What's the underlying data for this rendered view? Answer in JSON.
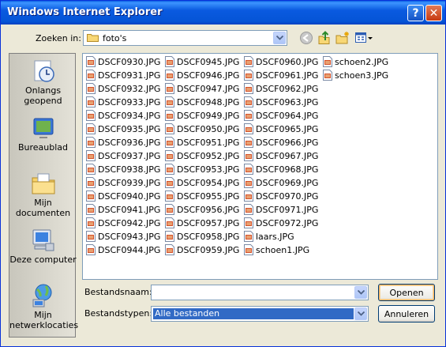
{
  "window": {
    "title": "Windows Internet Explorer"
  },
  "titlebar": {
    "help_glyph": "?",
    "close_glyph": "✕"
  },
  "lookin": {
    "label": "Zoeken in:",
    "value": "foto's"
  },
  "places": [
    {
      "label": "Onlangs geopend",
      "icon": "recent-icon"
    },
    {
      "label": "Bureaublad",
      "icon": "desktop-icon"
    },
    {
      "label": "Mijn documenten",
      "icon": "my-documents-icon"
    },
    {
      "label": "Deze computer",
      "icon": "my-computer-icon"
    },
    {
      "label": "Mijn netwerklocaties",
      "icon": "network-places-icon"
    }
  ],
  "files": {
    "col1": [
      "DSCF0930.JPG",
      "DSCF0931.JPG",
      "DSCF0932.JPG",
      "DSCF0933.JPG",
      "DSCF0934.JPG",
      "DSCF0935.JPG",
      "DSCF0936.JPG",
      "DSCF0937.JPG",
      "DSCF0938.JPG",
      "DSCF0939.JPG",
      "DSCF0940.JPG",
      "DSCF0941.JPG",
      "DSCF0942.JPG",
      "DSCF0943.JPG",
      "DSCF0944.JPG"
    ],
    "col2": [
      "DSCF0945.JPG",
      "DSCF0946.JPG",
      "DSCF0947.JPG",
      "DSCF0948.JPG",
      "DSCF0949.JPG",
      "DSCF0950.JPG",
      "DSCF0951.JPG",
      "DSCF0952.JPG",
      "DSCF0953.JPG",
      "DSCF0954.JPG",
      "DSCF0955.JPG",
      "DSCF0956.JPG",
      "DSCF0957.JPG",
      "DSCF0958.JPG",
      "DSCF0959.JPG"
    ],
    "col3": [
      "DSCF0960.JPG",
      "DSCF0961.JPG",
      "DSCF0962.JPG",
      "DSCF0963.JPG",
      "DSCF0964.JPG",
      "DSCF0965.JPG",
      "DSCF0966.JPG",
      "DSCF0967.JPG",
      "DSCF0968.JPG",
      "DSCF0969.JPG",
      "DSCF0970.JPG",
      "DSCF0971.JPG",
      "DSCF0972.JPG",
      "laars.JPG",
      "schoen1.JPG"
    ],
    "col4": [
      "schoen2.JPG",
      "schoen3.JPG"
    ]
  },
  "filename": {
    "label": "Bestandsnaam:",
    "value": ""
  },
  "filetype": {
    "label": "Bestandstypen:",
    "value": "Alle bestanden"
  },
  "buttons": {
    "open": "Openen",
    "cancel": "Annuleren"
  },
  "colors": {
    "titlebar": "#0a5ae0",
    "selection": "#316ac5",
    "dialog_bg": "#ece9d8"
  }
}
